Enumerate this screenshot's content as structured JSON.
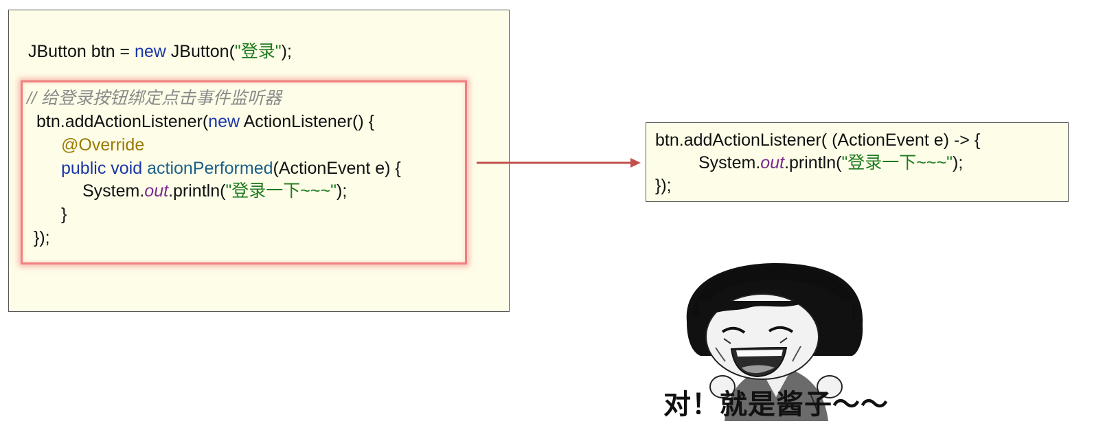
{
  "left_code": {
    "line1": {
      "a": "JButton btn = ",
      "kw": "new",
      "b": " JButton(",
      "str": "\"登录\"",
      "c": ");"
    },
    "comment": "// 给登录按钮绑定点击事件监听器",
    "line2": {
      "a": "btn.addActionListener(",
      "kw": "new",
      "b": " ActionListener() {"
    },
    "line3": {
      "anno": "@Override"
    },
    "line4": {
      "kw": "public void",
      "fn": "actionPerformed",
      "b": "(ActionEvent e) {"
    },
    "line5": {
      "a": "System.",
      "field": "out",
      "b": ".println(",
      "str": "\"登录一下~~~\"",
      "c": ");"
    },
    "line6": "}",
    "line7": "});"
  },
  "right_code": {
    "line1": "btn.addActionListener( (ActionEvent e) -> {",
    "line2": {
      "a": "System.",
      "field": "out",
      "b": ".println(",
      "str": "\"登录一下~~~\"",
      "c": ");"
    },
    "line3": "});"
  },
  "meme": {
    "caption": "对！就是酱子～～",
    "icon": "laughing-face-meme-icon"
  },
  "colors": {
    "keyword": "#1a36a8",
    "string": "#1e7a1e",
    "annotation": "#9a7b00",
    "highlight": "#f08080",
    "arrow": "#c0504d"
  }
}
